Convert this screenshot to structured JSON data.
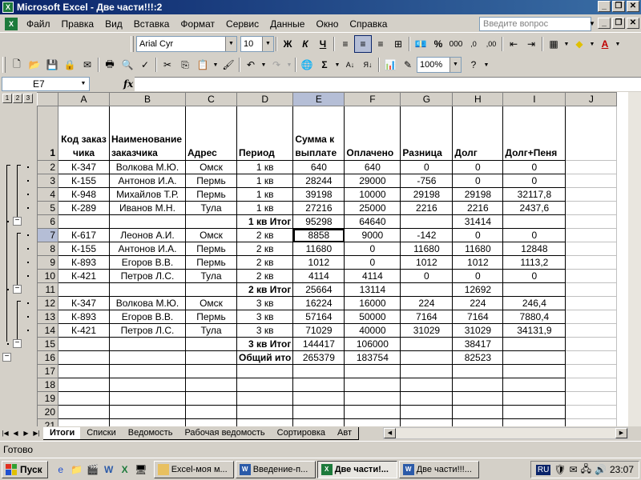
{
  "window": {
    "title": "Microsoft Excel - Две части!!!:2",
    "app_icon": "excel-icon",
    "buttons": [
      "_",
      "❐",
      "✕"
    ]
  },
  "menu": {
    "items": [
      "Файл",
      "Правка",
      "Вид",
      "Вставка",
      "Формат",
      "Сервис",
      "Данные",
      "Окно",
      "Справка"
    ],
    "help_placeholder": "Введите вопрос"
  },
  "format_toolbar": {
    "font": "Arial Cyr",
    "size": "10",
    "bold": "Ж",
    "italic": "К",
    "underline": "Ч",
    "percent": "%",
    "thousands": "000"
  },
  "standard_toolbar": {
    "zoom": "100%"
  },
  "formula_bar": {
    "name_box": "E7",
    "fx": "fx",
    "content": ""
  },
  "outline_levels": [
    "1",
    "2",
    "3"
  ],
  "sheet": {
    "columns": [
      "A",
      "B",
      "C",
      "D",
      "E",
      "F",
      "G",
      "H",
      "I",
      "J"
    ],
    "selected_column": "E",
    "selected_row": "7",
    "active_cell": "E7",
    "header_row": {
      "num": "1",
      "cells": [
        "Код заказчика",
        "Наименование заказчика",
        "Адрес",
        "Период",
        "Сумма к выплате",
        "Оплачено",
        "Разница",
        "Долг",
        "Долг+Пеня",
        ""
      ]
    },
    "rows": [
      {
        "num": "2",
        "cells": [
          "К-347",
          "Волкова М.Ю.",
          "Омск",
          "1 кв",
          "640",
          "640",
          "0",
          "0",
          "0",
          ""
        ]
      },
      {
        "num": "3",
        "cells": [
          "К-155",
          "Антонов И.А.",
          "Пермь",
          "1 кв",
          "28244",
          "29000",
          "-756",
          "0",
          "0",
          ""
        ]
      },
      {
        "num": "4",
        "cells": [
          "К-948",
          "Михайлов Т.Р.",
          "Пермь",
          "1 кв",
          "39198",
          "10000",
          "29198",
          "29198",
          "32117,8",
          ""
        ]
      },
      {
        "num": "5",
        "cells": [
          "К-289",
          "Иванов М.Н.",
          "Тула",
          "1 кв",
          "27216",
          "25000",
          "2216",
          "2216",
          "2437,6",
          ""
        ]
      },
      {
        "num": "6",
        "cells": [
          "",
          "",
          "",
          "1 кв Итог",
          "95298",
          "64640",
          "",
          "31414",
          "",
          ""
        ],
        "subtotal": true
      },
      {
        "num": "7",
        "cells": [
          "К-617",
          "Леонов А.И.",
          "Омск",
          "2 кв",
          "8858",
          "9000",
          "-142",
          "0",
          "0",
          ""
        ]
      },
      {
        "num": "8",
        "cells": [
          "К-155",
          "Антонов И.А.",
          "Пермь",
          "2 кв",
          "11680",
          "0",
          "11680",
          "11680",
          "12848",
          ""
        ]
      },
      {
        "num": "9",
        "cells": [
          "К-893",
          "Егоров В.В.",
          "Пермь",
          "2 кв",
          "1012",
          "0",
          "1012",
          "1012",
          "1113,2",
          ""
        ]
      },
      {
        "num": "10",
        "cells": [
          "К-421",
          "Петров Л.С.",
          "Тула",
          "2 кв",
          "4114",
          "4114",
          "0",
          "0",
          "0",
          ""
        ]
      },
      {
        "num": "11",
        "cells": [
          "",
          "",
          "",
          "2 кв Итог",
          "25664",
          "13114",
          "",
          "12692",
          "",
          ""
        ],
        "subtotal": true
      },
      {
        "num": "12",
        "cells": [
          "К-347",
          "Волкова М.Ю.",
          "Омск",
          "3 кв",
          "16224",
          "16000",
          "224",
          "224",
          "246,4",
          ""
        ]
      },
      {
        "num": "13",
        "cells": [
          "К-893",
          "Егоров В.В.",
          "Пермь",
          "3 кв",
          "57164",
          "50000",
          "7164",
          "7164",
          "7880,4",
          ""
        ]
      },
      {
        "num": "14",
        "cells": [
          "К-421",
          "Петров Л.С.",
          "Тула",
          "3 кв",
          "71029",
          "40000",
          "31029",
          "31029",
          "34131,9",
          ""
        ]
      },
      {
        "num": "15",
        "cells": [
          "",
          "",
          "",
          "3 кв Итог",
          "144417",
          "106000",
          "",
          "38417",
          "",
          ""
        ],
        "subtotal": true
      },
      {
        "num": "16",
        "cells": [
          "",
          "",
          "",
          "Общий ито",
          "265379",
          "183754",
          "",
          "82523",
          "",
          ""
        ],
        "subtotal": true
      },
      {
        "num": "17",
        "cells": [
          "",
          "",
          "",
          "",
          "",
          "",
          "",
          "",
          "",
          ""
        ]
      },
      {
        "num": "18",
        "cells": [
          "",
          "",
          "",
          "",
          "",
          "",
          "",
          "",
          "",
          ""
        ]
      },
      {
        "num": "19",
        "cells": [
          "",
          "",
          "",
          "",
          "",
          "",
          "",
          "",
          "",
          ""
        ]
      },
      {
        "num": "20",
        "cells": [
          "",
          "",
          "",
          "",
          "",
          "",
          "",
          "",
          "",
          ""
        ]
      },
      {
        "num": "21",
        "cells": [
          "",
          "",
          "",
          "",
          "",
          "",
          "",
          "",
          "",
          ""
        ]
      },
      {
        "num": "22",
        "cells": [
          "",
          "",
          "",
          "",
          "",
          "",
          "",
          "",
          "",
          ""
        ]
      }
    ]
  },
  "tabs": [
    "Итоги",
    "Списки",
    "Ведомость",
    "Рабочая ведомость",
    "Сортировка",
    "Авт"
  ],
  "active_tab": "Итоги",
  "status": "Готово",
  "taskbar": {
    "start": "Пуск",
    "buttons": [
      {
        "label": "Excel-моя м...",
        "icon": "folder-icon",
        "color": "#e8c060"
      },
      {
        "label": "Введение-п...",
        "icon": "word-icon",
        "color": "#2b5aa8"
      },
      {
        "label": "Две части!...",
        "icon": "excel-icon",
        "color": "#1d7a3b",
        "active": true
      },
      {
        "label": "Две части!!!...",
        "icon": "word-icon",
        "color": "#2b5aa8"
      }
    ],
    "lang": "RU",
    "clock": "23:07"
  }
}
